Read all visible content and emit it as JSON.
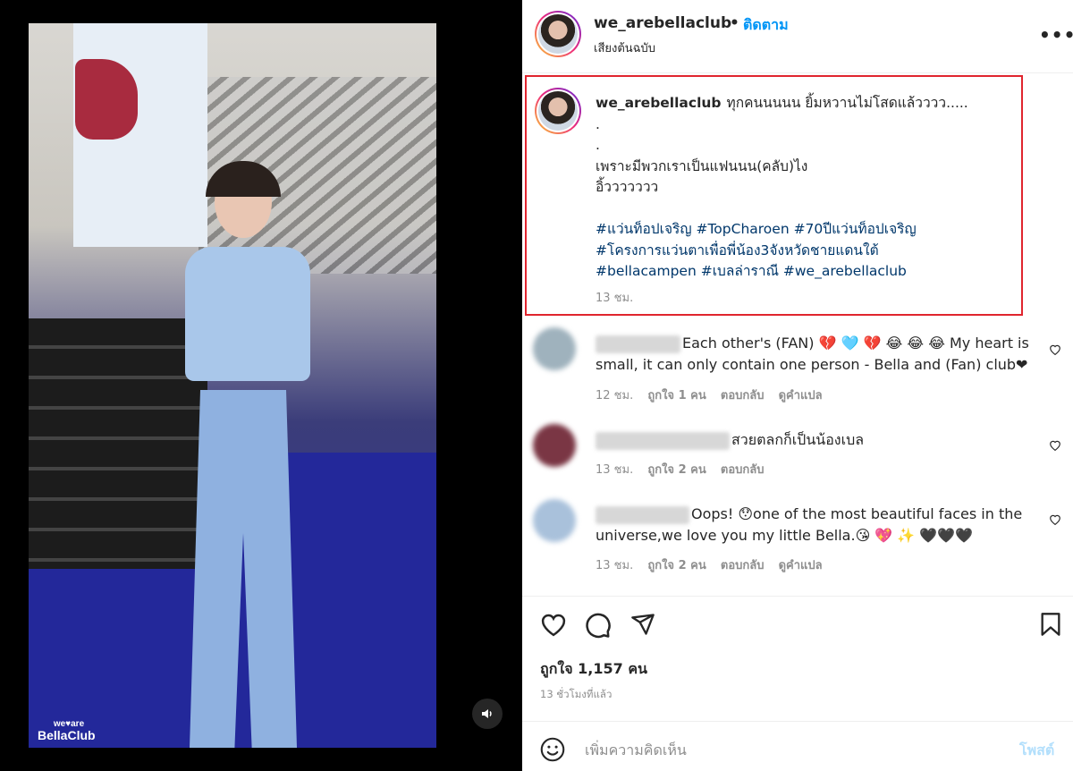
{
  "video": {
    "logo_top": "we♥are",
    "logo_bottom": "BellaClub"
  },
  "header": {
    "username": "we_arebellaclub",
    "separator": "•",
    "follow_label": "ติดตาม",
    "audio_label": "เสียงต้นฉบับ",
    "more_label": "•••"
  },
  "caption": {
    "username": "we_arebellaclub",
    "line1": "ทุกคนนนนน ยิ้มหวานไม่โสดแล้วววว.....",
    "line2": ".",
    "line3": ".",
    "line4": "เพราะมีพวกเราเป็นแฟนนน(คลับ)ไง",
    "line5": "อิ้ววววววว",
    "hashtags_line1": "#แว่นท็อปเจริญ #TopCharoen #70ปีแว่นท็อปเจริญ",
    "hashtags_line2": "#โครงการแว่นตาเพื่อพี่น้อง3จังหวัดชายแดนใต้",
    "hashtags_line3": "#bellacampen #เบลล่าราณี #we_arebellaclub",
    "time": "13 ชม."
  },
  "comments": [
    {
      "text_line1": "Each other's (FAN) 💔 🩵 💔 😂 😂 😂  My heart is",
      "text_line2": "small, it can only contain one person - Bella and (Fan) club❤",
      "time": "12 ชม.",
      "likes": "ถูกใจ 1 คน",
      "reply": "ตอบกลับ",
      "translate": "ดูคำแปล"
    },
    {
      "text_line1": "สวยตลกก็เป็นน้องเบล",
      "time": "13 ชม.",
      "likes": "ถูกใจ 2 คน",
      "reply": "ตอบกลับ"
    },
    {
      "text_line1": "Oops! 😯one of the most beautiful faces in the",
      "text_line2": "universe,we love you my little Bella.😘 💖 ✨ 🖤🖤🖤",
      "time": "13 ชม.",
      "likes": "ถูกใจ 2 คน",
      "reply": "ตอบกลับ",
      "translate": "ดูคำแปล"
    }
  ],
  "stats": {
    "likes": "ถูกใจ 1,157 คน",
    "time_ago": "13 ชั่วโมงที่แล้ว"
  },
  "add_comment": {
    "placeholder": "เพิ่มความคิดเห็น",
    "post_label": "โพสต์"
  }
}
